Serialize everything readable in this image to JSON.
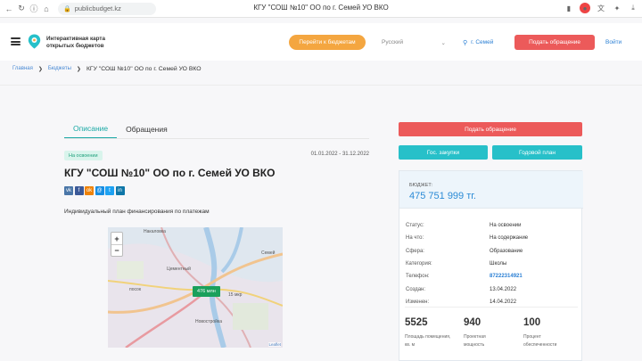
{
  "browser": {
    "url": "publicbudget.kz",
    "tab_title": "КГУ \"СОШ №10\" ОО по г. Семей УО ВКО"
  },
  "header": {
    "brand_line1": "Интерактивная карта",
    "brand_line2": "открытых бюджетов",
    "budgets_button": "Перейти к бюджетам",
    "language": "Русский",
    "city": "г. Семей",
    "appeal_button": "Подать обращение",
    "login": "Войти"
  },
  "breadcrumb": {
    "items": [
      "Главная",
      "Бюджеты"
    ],
    "current": "КГУ \"СОШ №10\" ОО по г. Семей УО ВКО"
  },
  "tabs": [
    {
      "label": "Описание",
      "active": true
    },
    {
      "label": "Обращения",
      "active": false
    }
  ],
  "main": {
    "status_badge": "На освоении",
    "period": "01.01.2022 - 31.12.2022",
    "title": "КГУ \"СОШ №10\" ОО по г. Семей УО ВКО",
    "social": [
      {
        "icon": "vk-icon",
        "glyph": "vk",
        "color": "#4a76a8"
      },
      {
        "icon": "facebook-icon",
        "glyph": "f",
        "color": "#3b5998"
      },
      {
        "icon": "odnoklassniki-icon",
        "glyph": "ok",
        "color": "#ee8208"
      },
      {
        "icon": "moimir-icon",
        "glyph": "@",
        "color": "#168de2"
      },
      {
        "icon": "twitter-icon",
        "glyph": "t",
        "color": "#1da1f2"
      },
      {
        "icon": "linkedin-icon",
        "glyph": "in",
        "color": "#0e76a8"
      }
    ],
    "description": "Индивидуальный план финансирования по платежам"
  },
  "map": {
    "zoom_in": "+",
    "zoom_out": "−",
    "marker": "476 млн",
    "labels": [
      "Накаловка",
      "Семей",
      "Цементный",
      "посок",
      "15 мкр",
      "Новостройка"
    ],
    "attribution": "Leaflet"
  },
  "sidebar": {
    "appeal_button": "Подать обращение",
    "procurement_button": "Гос. закупки",
    "annual_plan_button": "Годовой план",
    "budget_label": "БЮДЖЕТ:",
    "budget_amount": "475 751 999 тг.",
    "details": [
      {
        "key": "Статус:",
        "value": "На освоении"
      },
      {
        "key": "На что:",
        "value": "На содержание"
      },
      {
        "key": "Сфера:",
        "value": "Образование"
      },
      {
        "key": "Категория:",
        "value": "Школы"
      },
      {
        "key": "Телефон:",
        "value": "87222314921",
        "link": true
      },
      {
        "key": "Создан:",
        "value": "13.04.2022"
      },
      {
        "key": "Изменен:",
        "value": "14.04.2022"
      }
    ],
    "stats": [
      {
        "value": "5525",
        "label": "Площадь помещения, кв. м"
      },
      {
        "value": "940",
        "label": "Проектная мощность"
      },
      {
        "value": "100",
        "label": "Процент обеспеченности"
      }
    ]
  },
  "colors": {
    "accent": "#1aa9a5",
    "orange": "#f4a640",
    "red": "#ec5a5a",
    "blue": "#2b8bd6",
    "teal": "#27c0c9"
  }
}
